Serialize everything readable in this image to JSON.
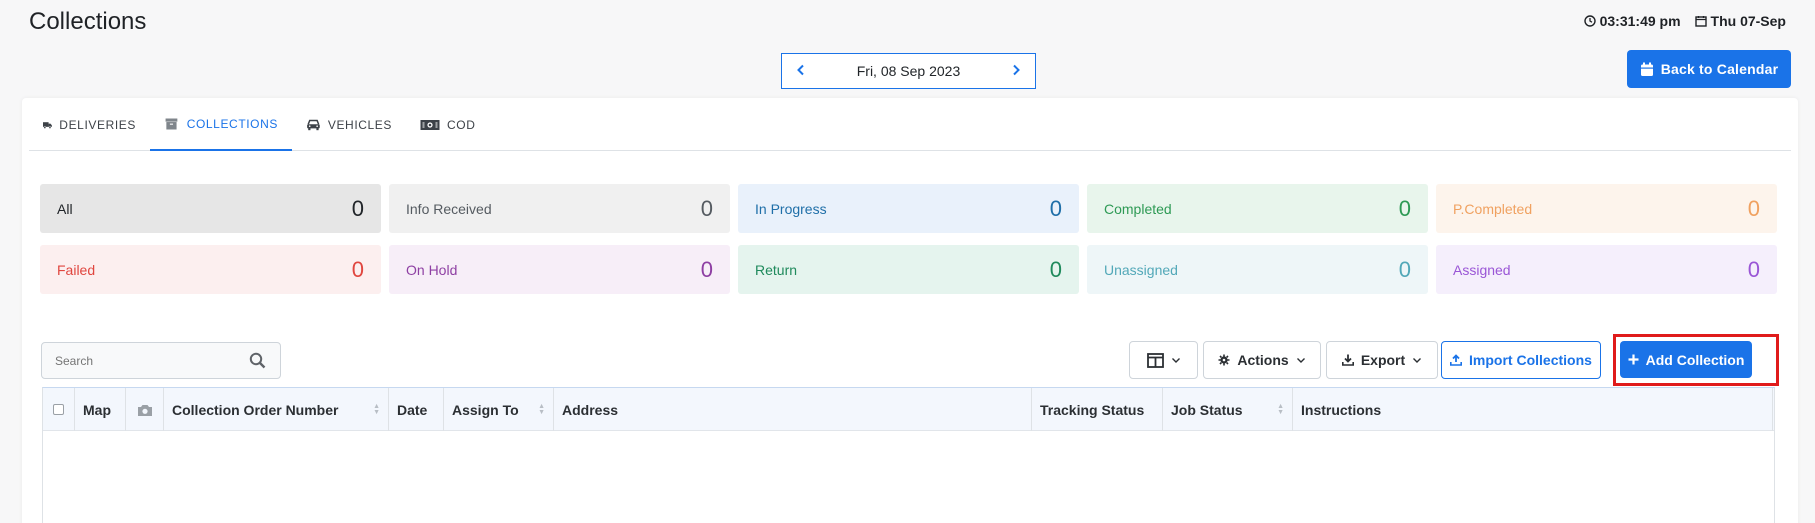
{
  "header": {
    "title": "Collections",
    "time": "03:31:49 pm",
    "date": "Thu 07-Sep"
  },
  "date_nav": {
    "current_date": "Fri, 08 Sep 2023"
  },
  "back_button": {
    "label": "Back to Calendar"
  },
  "tabs": [
    {
      "label": "DELIVERIES",
      "icon": "truck-icon"
    },
    {
      "label": "COLLECTIONS",
      "icon": "archive-box-icon",
      "active": true
    },
    {
      "label": "VEHICLES",
      "icon": "car-icon"
    },
    {
      "label": "COD",
      "icon": "money-bill-icon"
    }
  ],
  "stats": [
    {
      "label": "All",
      "count": "0",
      "bg": "#e6e6e6",
      "color": "#212529"
    },
    {
      "label": "Info Received",
      "count": "0",
      "bg": "#f0f0f0",
      "color": "#555b61"
    },
    {
      "label": "In Progress",
      "count": "0",
      "bg": "#e9f1fb",
      "color": "#1f6fa8"
    },
    {
      "label": "Completed",
      "count": "0",
      "bg": "#e8f5ec",
      "color": "#2e9a55"
    },
    {
      "label": "P.Completed",
      "count": "0",
      "bg": "#fdf4ec",
      "color": "#f0a160"
    },
    {
      "label": "Failed",
      "count": "0",
      "bg": "#fcefef",
      "color": "#e0463f"
    },
    {
      "label": "On Hold",
      "count": "0",
      "bg": "#f7eef8",
      "color": "#8e3fa3"
    },
    {
      "label": "Return",
      "count": "0",
      "bg": "#e5f4ee",
      "color": "#1f8a5c"
    },
    {
      "label": "Unassigned",
      "count": "0",
      "bg": "#eef6f8",
      "color": "#52a8b8"
    },
    {
      "label": "Assigned",
      "count": "0",
      "bg": "#f5effc",
      "color": "#9a56d6"
    }
  ],
  "toolbar": {
    "search_placeholder": "Search",
    "actions_label": "Actions",
    "export_label": "Export",
    "import_label": "Import Collections",
    "add_label": "Add Collection"
  },
  "table": {
    "columns": [
      "Map",
      "Collection Order Number",
      "Date",
      "Assign To",
      "Address",
      "Tracking Status",
      "Job Status",
      "Instructions"
    ]
  },
  "colors": {
    "accent": "#1a73e8",
    "highlight": "#e01b1b"
  }
}
